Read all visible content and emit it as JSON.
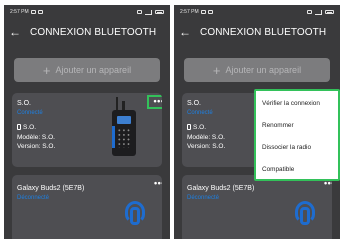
{
  "status_bar": {
    "time": "2:57 PM"
  },
  "header": {
    "title": "CONNEXION BLUETOOTH"
  },
  "add_button": {
    "label": "Ajouter un appareil"
  },
  "devices": [
    {
      "name": "S.O.",
      "subtitle": "Connecté",
      "battery": "S.O.",
      "model": "Modèle: S.O.",
      "version": "Version: S.O."
    },
    {
      "name": "Galaxy Buds2 (5E7B)",
      "subtitle": "Déconnecté"
    }
  ],
  "more_label": "•••",
  "context_menu": {
    "items": [
      "Vérifier la connexion",
      "Renommer",
      "Dissocier la radio",
      "Compatible"
    ]
  },
  "colors": {
    "accent": "#1e7fe0",
    "highlight": "#33c15a",
    "background": "#3a3a3c",
    "card": "#4e4e52"
  }
}
